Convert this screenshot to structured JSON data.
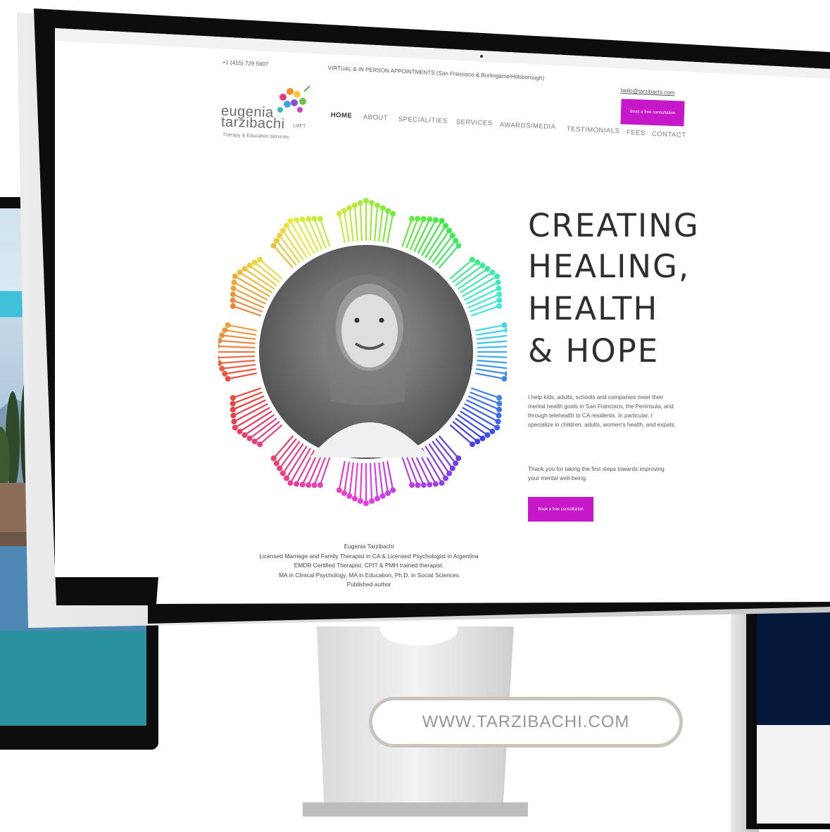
{
  "site": {
    "topbar": {
      "phone": "+1 (415) 729 5907",
      "appointments": "VIRTUAL & IN PERSON APPOINTMENTS (San Francisco & Burlingame/Hillsborough)",
      "email": "hello@tarzibachi.com"
    },
    "logo": {
      "line1": "eugenia",
      "line2": "tarzibachi",
      "credential": "LMFT",
      "tagline": "Therapy & Education Services"
    },
    "nav": {
      "items": [
        "HOME",
        "ABOUT",
        "SPECIALITIES",
        "SERVICES",
        "AWARDS/MEDIA",
        "TESTIMONIALS",
        "FEES",
        "CONTACT"
      ],
      "active": "HOME",
      "cta_label": "Book a free consultation"
    },
    "hero": {
      "headline": [
        "CREATING",
        "HEALING,",
        "HEALTH",
        "& HOPE"
      ],
      "paragraph1": "I help kids, adults, schools and companies meet their mental health goals in San Francisco, the Peninsula, and through telehealth to CA residents. In particular, I specialize in children, adults, women's health, and expats.",
      "paragraph2": "Thank you for taking the first steps towards improving your mental well-being.",
      "cta_label": "Book a free consultation"
    },
    "caption": {
      "name": "Eugenia Tarzibachi",
      "line1": "Licensed Marriage and Family Therapist in CA & Licensed Psychologist in Argentina",
      "line2": "EMDR Certified Therapist. CPIT & PMH trained therapist.",
      "line3": "MA in Clinical Psychology, MA in Education, Ph.D. in Social Sciences",
      "line4": "Published author"
    }
  },
  "url_pill": {
    "text": "WWW.TARZIBACHI.COM"
  },
  "colors": {
    "accent": "#c617c9",
    "bezel": "#0d0d0d",
    "pill_border": "#c9c4bd",
    "pill_text": "#9c958d"
  }
}
